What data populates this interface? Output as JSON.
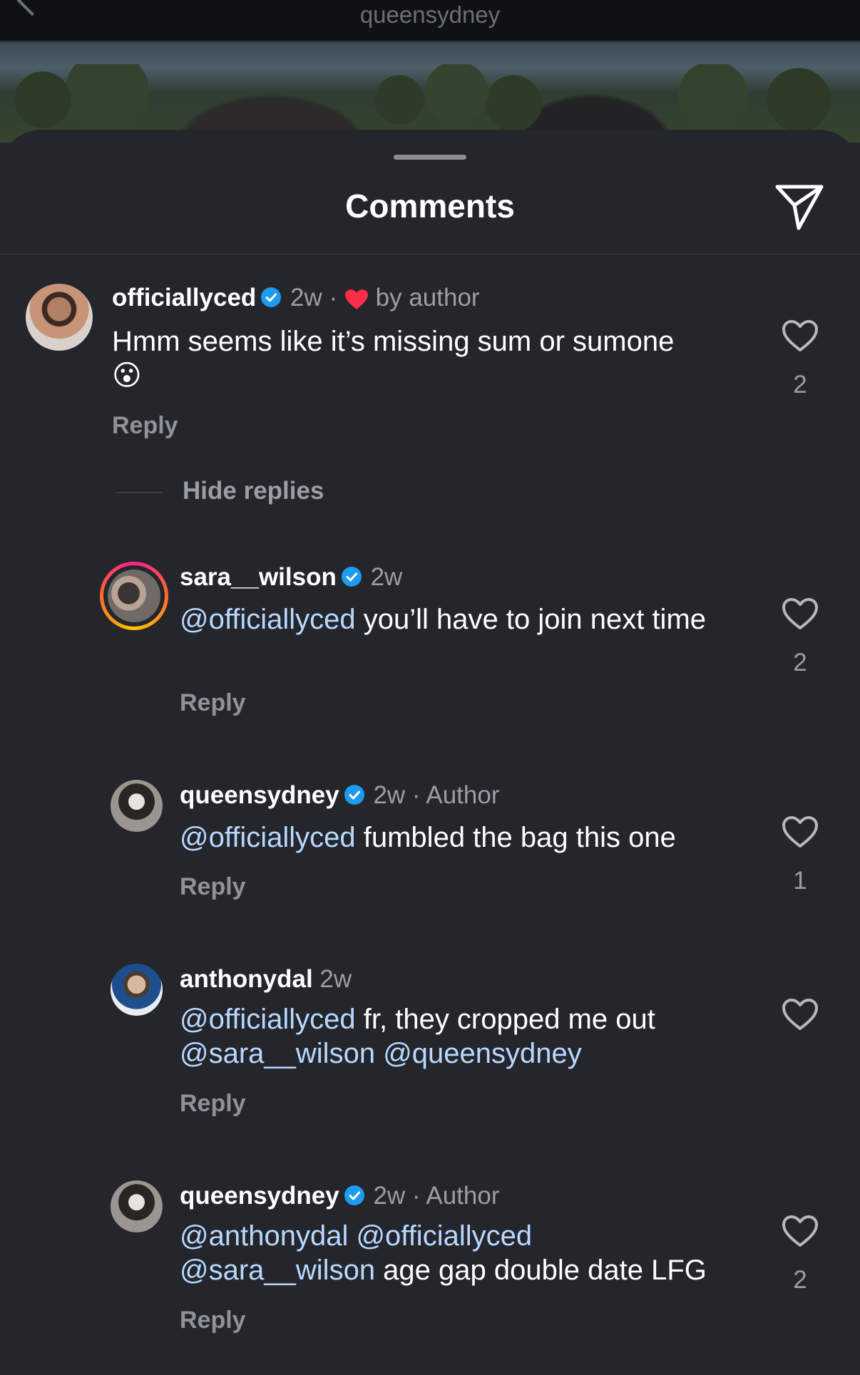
{
  "header": {
    "title": "queensydney"
  },
  "sheet": {
    "title": "Comments"
  },
  "hide_replies_label": "Hide replies",
  "comments": [
    {
      "username": "officiallyced",
      "time": "2w",
      "separator": "·",
      "author_like": "by author",
      "text": "Hmm seems like it’s missing sum or sumone",
      "emoji": "😮",
      "reply_label": "Reply",
      "likes": "2"
    },
    {
      "username": "sara__wilson",
      "time": "2w",
      "mention1": "@officiallyced",
      "text": " you’ll have to join next time",
      "reply_label": "Reply",
      "likes": "2"
    },
    {
      "username": "queensydney",
      "time": "2w",
      "badge": "· Author",
      "mention1": "@officiallyced",
      "text": " fumbled the bag this one",
      "reply_label": "Reply",
      "likes": "1"
    },
    {
      "username": "anthonydal",
      "time": "2w",
      "mention1": "@officiallyced",
      "text": " fr, they cropped me out",
      "mention2": "@sara__wilson",
      "mention3": "@queensydney",
      "reply_label": "Reply"
    },
    {
      "username": "queensydney",
      "time": "2w",
      "badge": "· Author",
      "mention1": "@anthonydal",
      "mention2": "@officiallyced",
      "mention3": "@sara__wilson",
      "text": " age gap double date LFG",
      "reply_label": "Reply",
      "likes": "2"
    }
  ],
  "colors": {
    "background": "#24262c",
    "mention": "#b8d8ff",
    "verified": "#1d9bf0",
    "heart_red": "#ff2d45"
  },
  "icons": [
    "send-icon",
    "heart-outline-icon",
    "verified-badge-icon",
    "red-heart-icon"
  ]
}
